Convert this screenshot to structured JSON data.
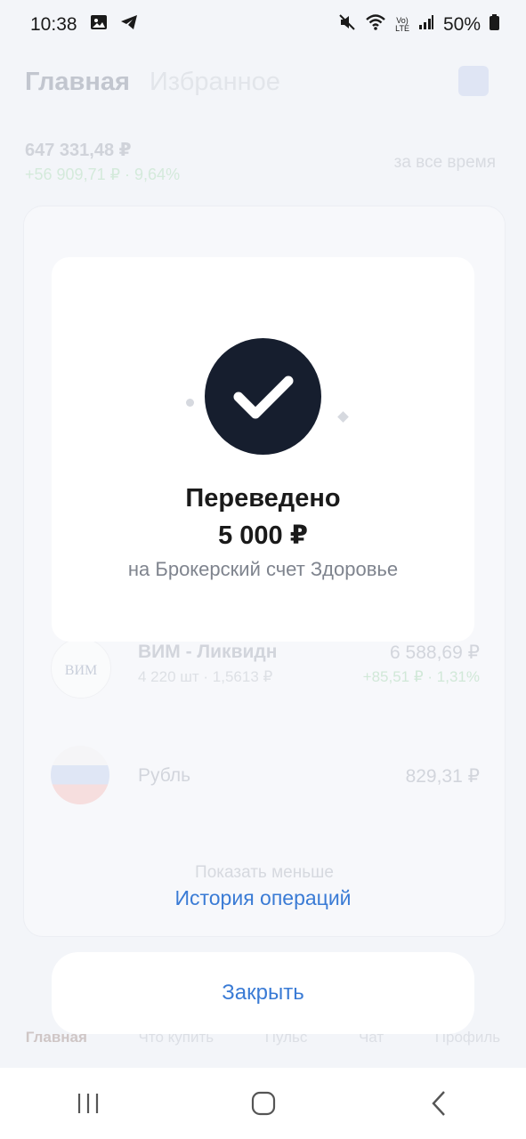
{
  "status_bar": {
    "time": "10:38",
    "volte_top": "Vo)",
    "volte_bottom": "LTE",
    "battery": "50%"
  },
  "background": {
    "tabs": [
      "Главная",
      "Избранное"
    ],
    "portfolio_total": "647 331,48 ₽",
    "portfolio_change": "+56 909,71 ₽ · 9,64%",
    "period": "за все время",
    "rows": [
      {
        "name": "ВИМ - Ликвидн",
        "sub": "4 220 шт · 1,5613 ₽",
        "value": "6 588,69 ₽",
        "gain": "+85,51 ₽ · 1,31%"
      },
      {
        "name": "Рубль",
        "sub": "",
        "value": "829,31 ₽",
        "gain": ""
      }
    ],
    "show_less": "Показать меньше",
    "bottom_nav": [
      "Главная",
      "Что купить",
      "Пульс",
      "Чат",
      "Профиль"
    ]
  },
  "modal": {
    "title": "Переведено",
    "amount": "5 000 ₽",
    "description": "на Брокерский счет Здоровье"
  },
  "history_link": "История операций",
  "close_button": "Закрыть",
  "colors": {
    "accent": "#3a7bd5",
    "check_circle": "#161e2e",
    "gain_green": "#d1e8d8"
  }
}
